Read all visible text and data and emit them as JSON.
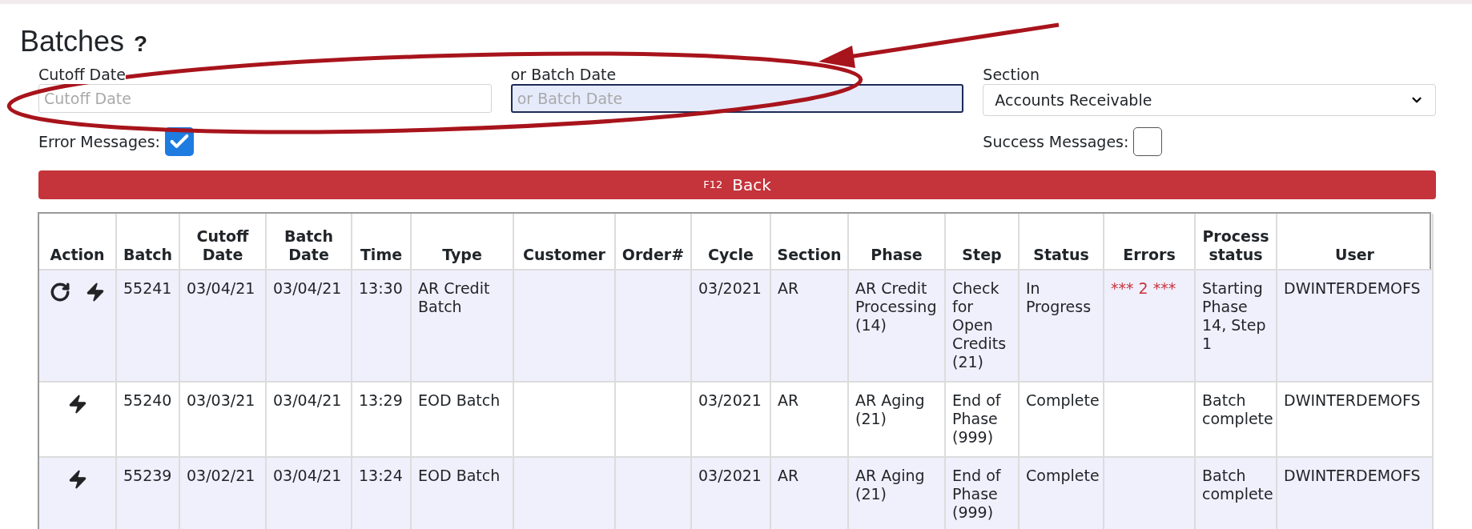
{
  "title": "Batches",
  "help": "?",
  "filters": {
    "cutoff_date": {
      "label": "Cutoff Date",
      "placeholder": "Cutoff Date",
      "focused": false
    },
    "batch_date": {
      "label": "or Batch Date",
      "placeholder": "or Batch Date",
      "focused": true
    },
    "section": {
      "label": "Section",
      "value": "Accounts Receivable"
    },
    "error_messages": {
      "label": "Error Messages:",
      "checked": true
    },
    "success_messages": {
      "label": "Success Messages:",
      "checked": false
    }
  },
  "back_button": {
    "shortcut": "F12",
    "label": "Back"
  },
  "table": {
    "action_column": "Action",
    "columns": [
      "Batch",
      "Cutoff Date",
      "Batch Date",
      "Time",
      "Type",
      "Customer",
      "Order#",
      "Cycle",
      "Section",
      "Phase",
      "Step",
      "Status",
      "Errors",
      "Process status",
      "User"
    ],
    "rows": [
      {
        "actions": [
          {
            "kind": "retry"
          },
          {
            "kind": "run"
          }
        ],
        "cells": [
          "55241",
          "03/04/21",
          "03/04/21",
          "13:30",
          "AR Credit Batch",
          "",
          "",
          "03/2021",
          "AR",
          "AR Credit Processing (14)",
          "Check for Open Credits (21)",
          "In Progress",
          "*** 2 ***",
          "Starting Phase 14, Step 1",
          "DWINTERDEMOFS"
        ]
      },
      {
        "actions": [
          {
            "kind": "run"
          }
        ],
        "cells": [
          "55240",
          "03/03/21",
          "03/04/21",
          "13:29",
          "EOD Batch",
          "",
          "",
          "03/2021",
          "AR",
          "AR Aging (21)",
          "End of Phase (999)",
          "Complete",
          "",
          "Batch complete",
          "DWINTERDEMOFS"
        ]
      },
      {
        "actions": [
          {
            "kind": "run"
          }
        ],
        "cells": [
          "55239",
          "03/02/21",
          "03/04/21",
          "13:24",
          "EOD Batch",
          "",
          "",
          "03/2021",
          "AR",
          "AR Aging (21)",
          "End of Phase (999)",
          "Complete",
          "",
          "Batch complete",
          "DWINTERDEMOFS"
        ]
      }
    ]
  }
}
